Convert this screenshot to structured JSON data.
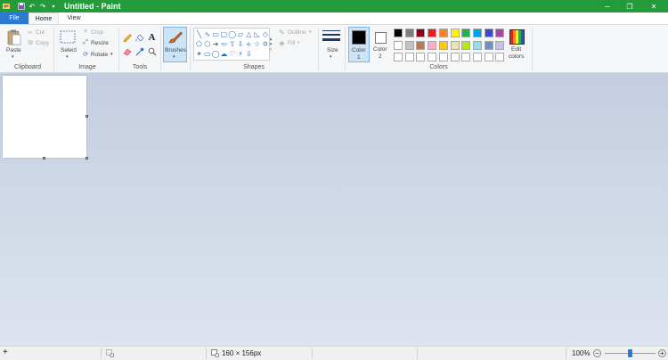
{
  "window": {
    "title": "Untitled - Paint",
    "quick_access": [
      "app-icon",
      "save-icon",
      "undo-icon",
      "redo-icon",
      "customize-dropdown-icon"
    ],
    "controls": [
      "minimize-icon",
      "restore-icon",
      "close-icon"
    ],
    "accent_color": "#239b3b"
  },
  "tabs": {
    "file": "File",
    "home": "Home",
    "view": "View"
  },
  "ribbon": {
    "clipboard": {
      "label": "Clipboard",
      "paste": "Paste",
      "cut": "Cut",
      "copy": "Copy"
    },
    "image": {
      "label": "Image",
      "select": "Select",
      "crop": "Crop",
      "resize": "Resize",
      "rotate": "Rotate"
    },
    "tools": {
      "label": "Tools",
      "items": [
        "pencil-icon",
        "fill-icon",
        "text-icon",
        "eraser-icon",
        "color-picker-icon",
        "magnifier-icon"
      ]
    },
    "brushes": {
      "label": "Brushes"
    },
    "shapes": {
      "label": "Shapes",
      "outline": "Outline",
      "fill": "Fill",
      "glyphs": [
        "╲",
        "∿",
        "▭",
        "▢",
        "◯",
        "▱",
        "△",
        "◺",
        "◇",
        "⬠",
        "⬡",
        "➜",
        "⇦",
        "⇧",
        "⇩",
        "⟡",
        "☆",
        "✡",
        "✶",
        "▭",
        "◯",
        "☁",
        "♡",
        "⚡",
        "⇩"
      ]
    },
    "size": {
      "label": "Size"
    },
    "colors": {
      "label": "Colors",
      "color1_label": "Color",
      "color1_num": "1",
      "color2_label": "Color",
      "color2_num": "2",
      "color1_value": "#000000",
      "color2_value": "#ffffff",
      "edit_label": "Edit",
      "edit_label2": "colors",
      "palette_row1": [
        "#000000",
        "#7f7f7f",
        "#880015",
        "#ed1c24",
        "#ff7f27",
        "#fff200",
        "#22b14c",
        "#00a2e8",
        "#3f48cc",
        "#a349a4"
      ],
      "palette_row2": [
        "#ffffff",
        "#c3c3c3",
        "#b97a57",
        "#ffaec9",
        "#ffc90e",
        "#efe4b0",
        "#b5e61d",
        "#99d9ea",
        "#7092be",
        "#c8bfe7"
      ],
      "palette_row3": [
        "#ffffff",
        "#ffffff",
        "#ffffff",
        "#ffffff",
        "#ffffff",
        "#ffffff",
        "#ffffff",
        "#ffffff",
        "#ffffff",
        "#ffffff"
      ]
    }
  },
  "canvas": {
    "background": "#ffffff"
  },
  "status": {
    "add_icon": "+",
    "canvas_size": "160 × 156px",
    "zoom": "100%",
    "zoom_level": 0.5
  }
}
